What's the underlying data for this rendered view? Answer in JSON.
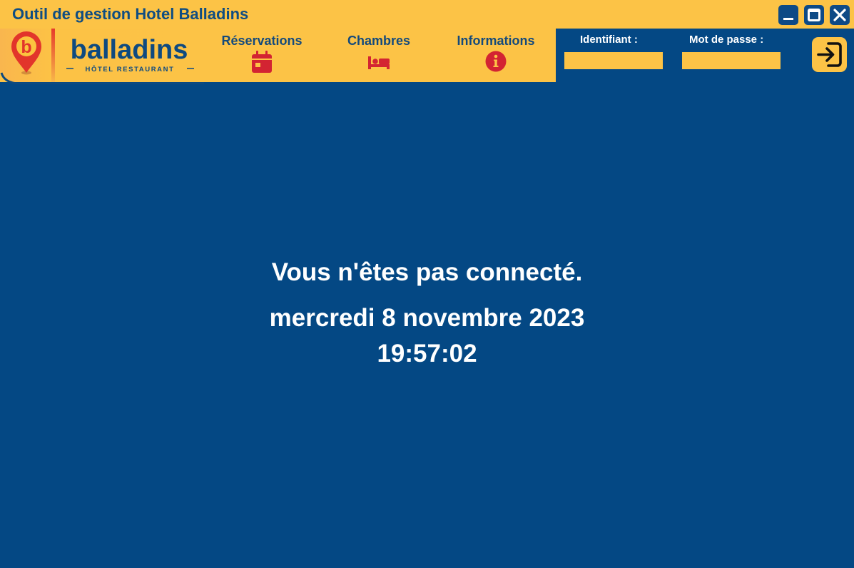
{
  "window": {
    "title": "Outil de gestion Hotel Balladins",
    "controls": [
      {
        "name": "minimize",
        "icon": "minimize-icon"
      },
      {
        "name": "maximize",
        "icon": "maximize-icon"
      },
      {
        "name": "close",
        "icon": "close-icon"
      }
    ]
  },
  "logo": {
    "brand": "balladins",
    "tagline": "HÔTEL RESTAURANT",
    "initial": "b"
  },
  "nav": {
    "items": [
      {
        "label": "Réservations",
        "icon": "calendar-icon"
      },
      {
        "label": "Chambres",
        "icon": "bed-icon"
      },
      {
        "label": "Informations",
        "icon": "info-icon"
      }
    ]
  },
  "login": {
    "username_label": "Identifiant :",
    "username_value": "",
    "password_label": "Mot de passe :",
    "password_value": "",
    "submit_icon": "login-icon"
  },
  "main": {
    "status": "Vous n'êtes pas connecté.",
    "date": "mercredi 8 novembre 2023",
    "time": "19:57:02"
  },
  "colors": {
    "background": "#044884",
    "accent": "#fcc346",
    "nav_text": "#144a7c",
    "icon_red": "#d32432",
    "button_blue": "#0d4a86"
  }
}
